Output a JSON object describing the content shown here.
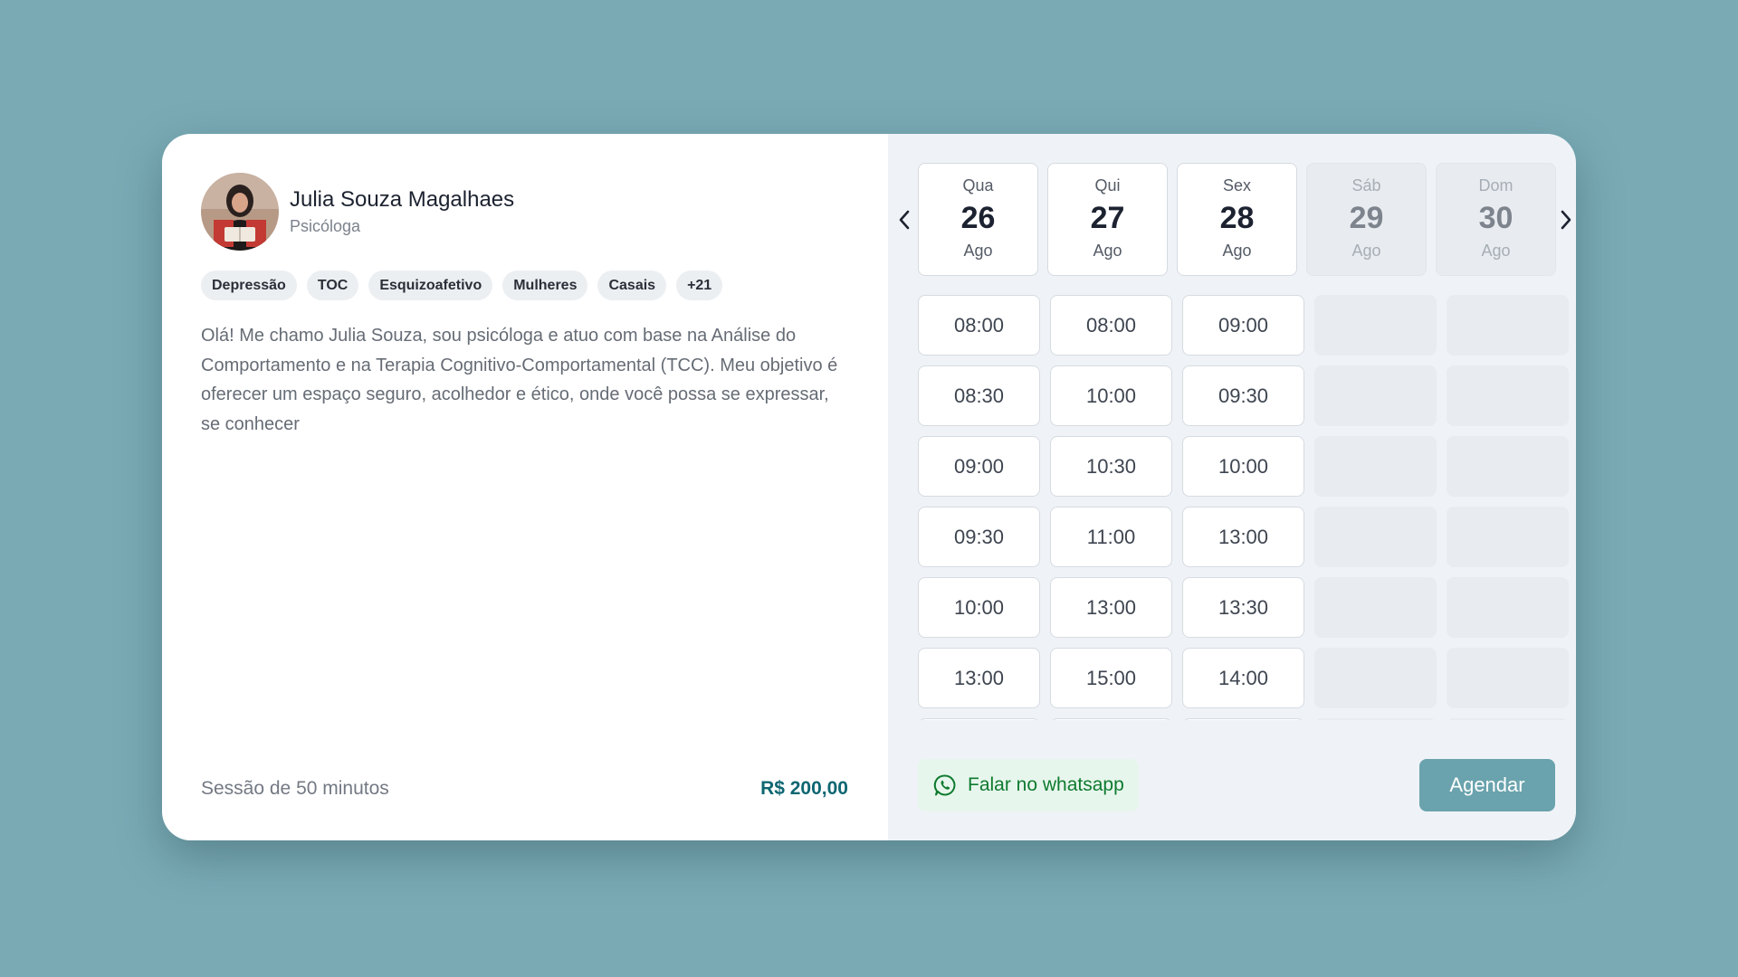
{
  "profile": {
    "name": "Julia Souza Magalhaes",
    "role": "Psicóloga"
  },
  "tags": [
    "Depressão",
    "TOC",
    "Esquizoafetivo",
    "Mulheres",
    "Casais",
    "+21"
  ],
  "bio": "Olá! Me chamo Julia Souza, sou psicóloga e atuo com base na Análise do Comportamento e na Terapia Cognitivo-Comportamental (TCC). Meu objetivo é oferecer um espaço seguro, acolhedor e ético, onde você possa se expressar, se conhecer",
  "session": {
    "duration_label": "Sessão de 50 minutos",
    "price": "R$ 200,00"
  },
  "calendar": {
    "days": [
      {
        "weekday": "Qua",
        "day": "26",
        "month": "Ago",
        "disabled": false,
        "slots": [
          "08:00",
          "08:30",
          "09:00",
          "09:30",
          "10:00",
          "13:00"
        ]
      },
      {
        "weekday": "Qui",
        "day": "27",
        "month": "Ago",
        "disabled": false,
        "slots": [
          "08:00",
          "10:00",
          "10:30",
          "11:00",
          "13:00",
          "15:00"
        ]
      },
      {
        "weekday": "Sex",
        "day": "28",
        "month": "Ago",
        "disabled": false,
        "slots": [
          "09:00",
          "09:30",
          "10:00",
          "13:00",
          "13:30",
          "14:00"
        ]
      },
      {
        "weekday": "Sáb",
        "day": "29",
        "month": "Ago",
        "disabled": true,
        "slots": []
      },
      {
        "weekday": "Dom",
        "day": "30",
        "month": "Ago",
        "disabled": true,
        "slots": []
      }
    ]
  },
  "actions": {
    "whatsapp_label": "Falar no whatsapp",
    "whatsapp_icon": "whatsapp-icon",
    "book_label": "Agendar"
  },
  "colors": {
    "background": "#7aabb5",
    "price": "#0e6672",
    "book_button": "#6aa3ad",
    "whatsapp_text": "#0e7a2f"
  }
}
